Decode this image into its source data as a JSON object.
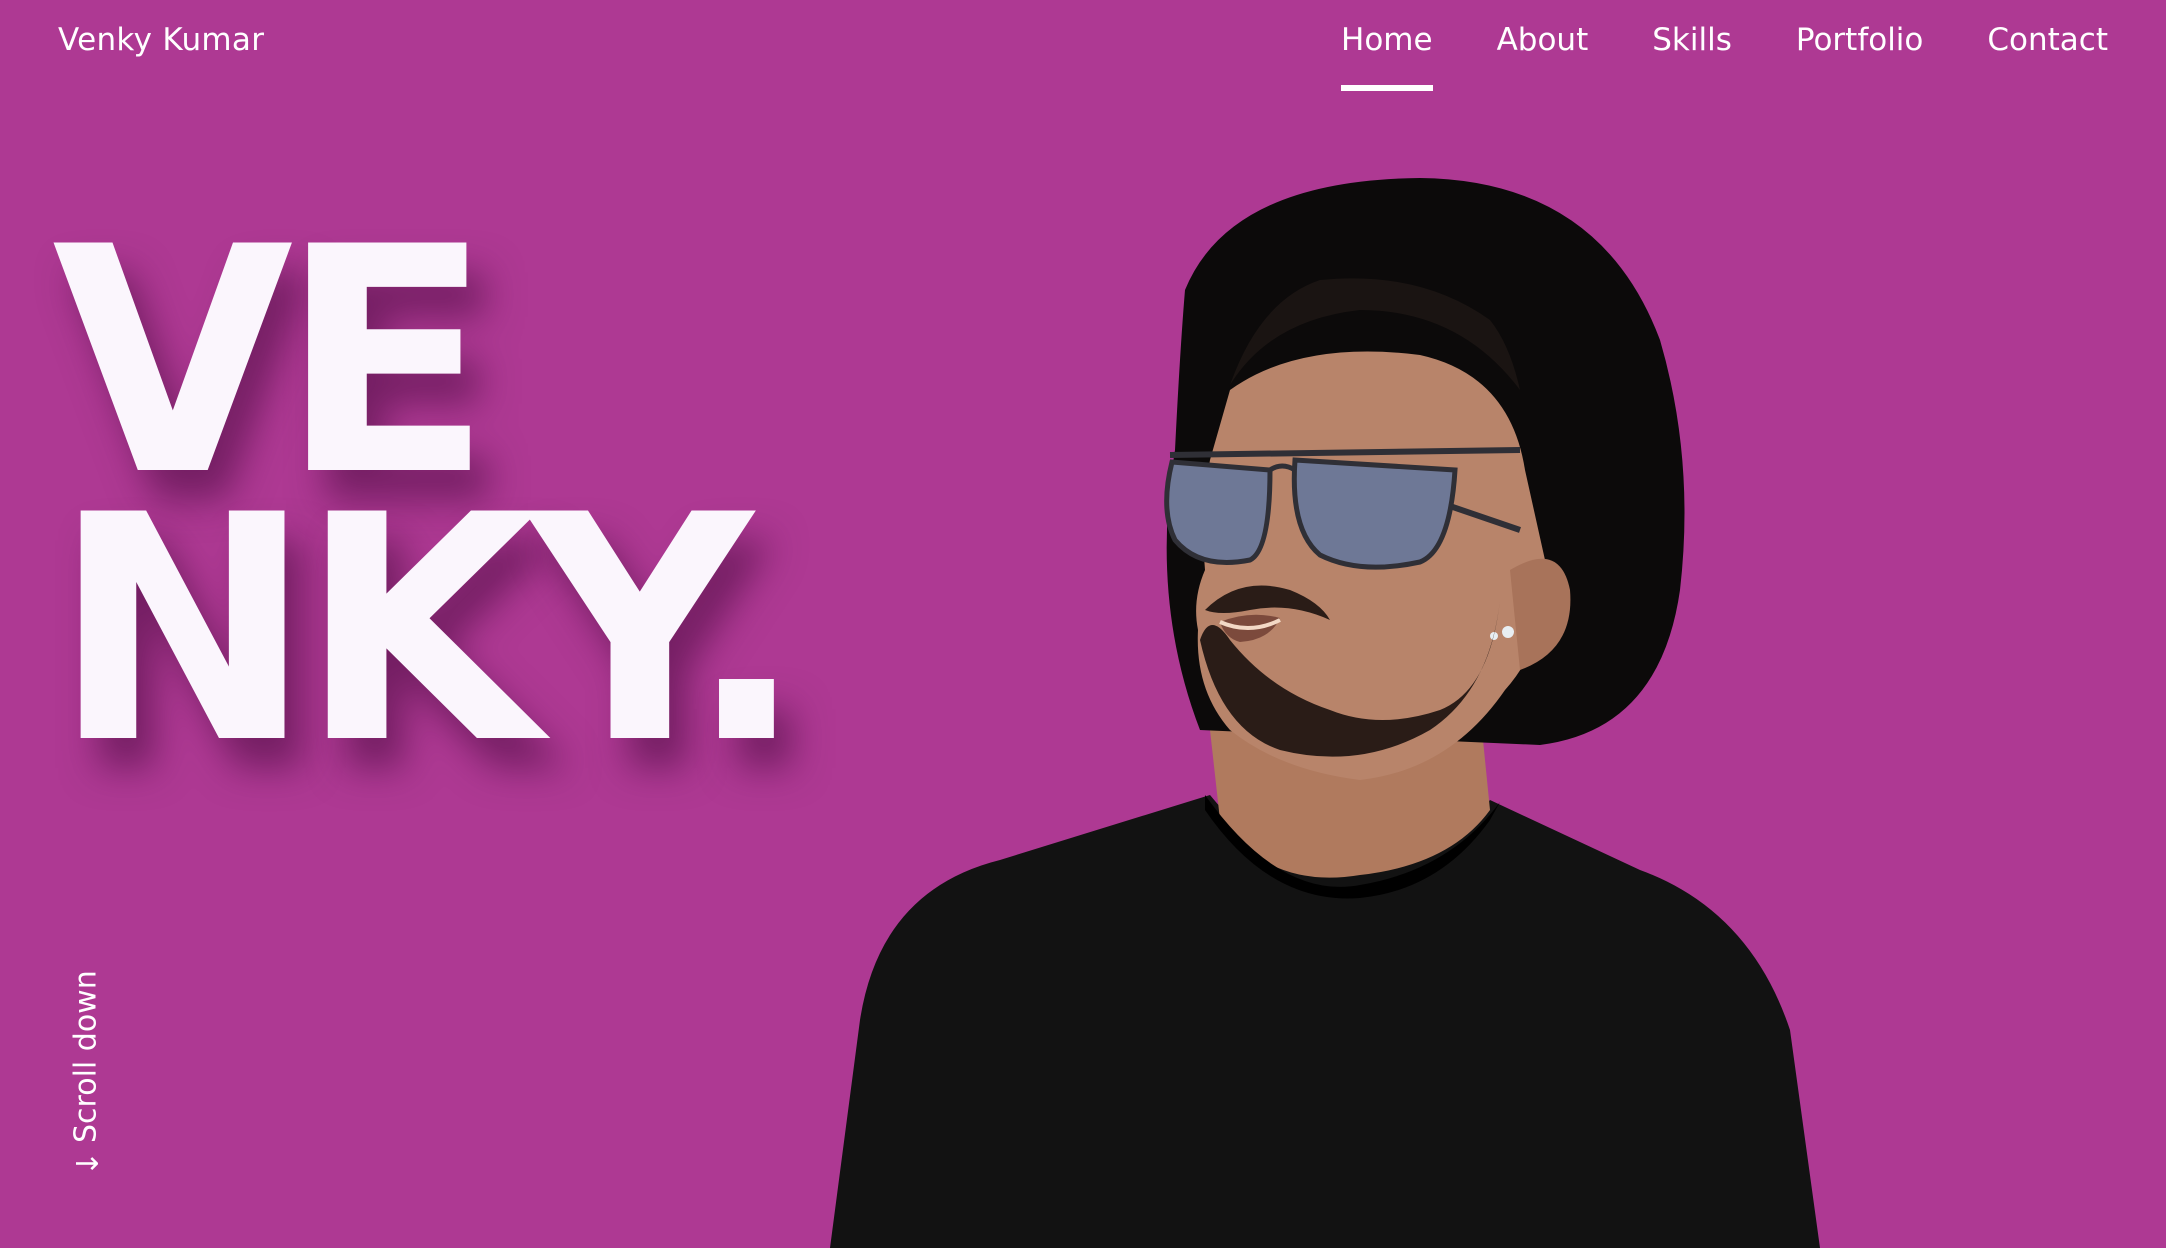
{
  "brand": {
    "name": "Venky Kumar"
  },
  "nav": {
    "items": [
      {
        "label": "Home",
        "active": true
      },
      {
        "label": "About",
        "active": false
      },
      {
        "label": "Skills",
        "active": false
      },
      {
        "label": "Portfolio",
        "active": false
      },
      {
        "label": "Contact",
        "active": false
      }
    ]
  },
  "hero": {
    "line1": "VE",
    "line2": "NKY."
  },
  "scroll": {
    "label": "Scroll down",
    "icon": "arrow-down-icon"
  },
  "portrait": {
    "alt": "portrait-photo"
  },
  "colors": {
    "background": "#ae3993",
    "text": "#ffffff",
    "title": "#fbf6fd"
  }
}
